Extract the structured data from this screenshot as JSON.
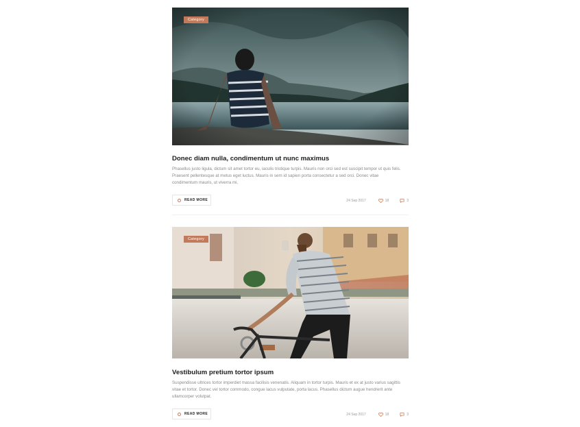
{
  "posts": [
    {
      "category": "Category",
      "title": "Donec diam nulla, condimentum ut nunc maximus",
      "excerpt": "Phasellus justo ligula, dictum sit amet tortor eu, iaculis tristique turpis. Mauris non orci sed est suscipit tempor ut quis felis. Praesent pellentesque at metus eget luctus. Mauris in sem id sapien porta consectetur a sed orci. Donec vitae condimentum mauris, ut viverra mi.",
      "read_more": "READ MORE",
      "date": "24 Sep 2017",
      "likes": "18",
      "comments": "3"
    },
    {
      "category": "Category",
      "title": "Vestibulum pretium tortor ipsum",
      "excerpt": "Suspendisse ultrices tortor imperdiet massa facilisis venenatis. Aliquam in tortor turpis. Mauris et ex at justo varius sagittis vitae et tortor. Donec vel tortor commodo, congue lacus vulputate, porta lacus. Phasellus dictum augue hendrerit ante ullamcorper volutpat.",
      "read_more": "READ MORE",
      "date": "24 Sep 2017",
      "likes": "18",
      "comments": "3"
    }
  ],
  "icons": {
    "read_more": "circle-icon",
    "likes": "heart-icon",
    "comments": "comment-icon"
  },
  "colors": {
    "accent": "#c27a5a",
    "title": "#1c1c1c",
    "text": "#8a8a8a"
  }
}
